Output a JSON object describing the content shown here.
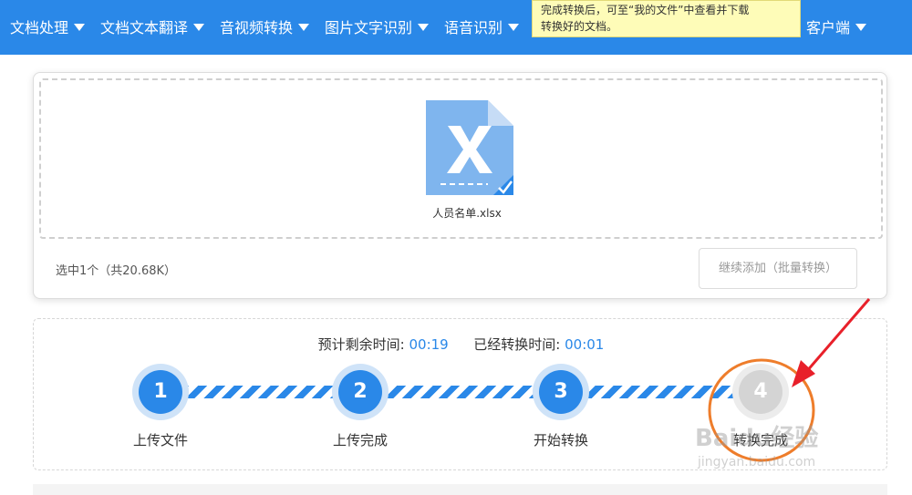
{
  "nav": {
    "items": [
      {
        "label": "文档处理"
      },
      {
        "label": "文档文本翻译"
      },
      {
        "label": "音视频转换"
      },
      {
        "label": "图片文字识别"
      },
      {
        "label": "语音识别"
      },
      {
        "label": "客户端"
      }
    ],
    "tooltip_line1": "完成转换后，可至“我的文件”中查看并下载",
    "tooltip_line2": "转换好的文档。"
  },
  "upload": {
    "file_name": "人员名单.xlsx",
    "file_icon": "excel-file-icon",
    "selection_info": "选中1个（共20.68K）",
    "add_more_label": "继续添加（批量转换）"
  },
  "progress": {
    "remaining_label": "预计剩余时间:",
    "remaining_value": "00:19",
    "elapsed_label": "已经转换时间:",
    "elapsed_value": "00:01",
    "steps": [
      {
        "number": "1",
        "label": "上传文件",
        "state": "done"
      },
      {
        "number": "2",
        "label": "上传完成",
        "state": "done"
      },
      {
        "number": "3",
        "label": "开始转换",
        "state": "done"
      },
      {
        "number": "4",
        "label": "转换完成",
        "state": "pending"
      }
    ]
  },
  "watermark": {
    "text": "Baidu经验",
    "url": "jingyan.baidu.com"
  },
  "colors": {
    "nav_bg": "#2a88e8",
    "accent": "#2a88e8",
    "annotation_orange": "#ee7d2b",
    "annotation_red": "#e8202a",
    "tooltip_bg": "#fefcb8"
  }
}
